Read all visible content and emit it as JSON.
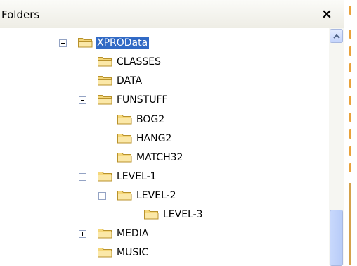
{
  "panel": {
    "title": "Folders",
    "close_label": "×"
  },
  "tree": {
    "nodes": [
      {
        "label": "XPROData",
        "expander": "minus",
        "selected": true
      },
      {
        "label": "CLASSES",
        "expander": "none",
        "selected": false
      },
      {
        "label": "DATA",
        "expander": "none",
        "selected": false
      },
      {
        "label": "FUNSTUFF",
        "expander": "minus",
        "selected": false
      },
      {
        "label": "BOG2",
        "expander": "none",
        "selected": false
      },
      {
        "label": "HANG2",
        "expander": "none",
        "selected": false
      },
      {
        "label": "MATCH32",
        "expander": "none",
        "selected": false
      },
      {
        "label": "LEVEL-1",
        "expander": "minus",
        "selected": false
      },
      {
        "label": "LEVEL-2",
        "expander": "minus",
        "selected": false
      },
      {
        "label": "LEVEL-3",
        "expander": "none",
        "selected": false
      },
      {
        "label": "MEDIA",
        "expander": "plus",
        "selected": false
      },
      {
        "label": "MUSIC",
        "expander": "none",
        "selected": false
      }
    ]
  },
  "colors": {
    "selection": "#316ac5",
    "folder_fill": "#f5d77a",
    "folder_stroke": "#b8922c"
  }
}
